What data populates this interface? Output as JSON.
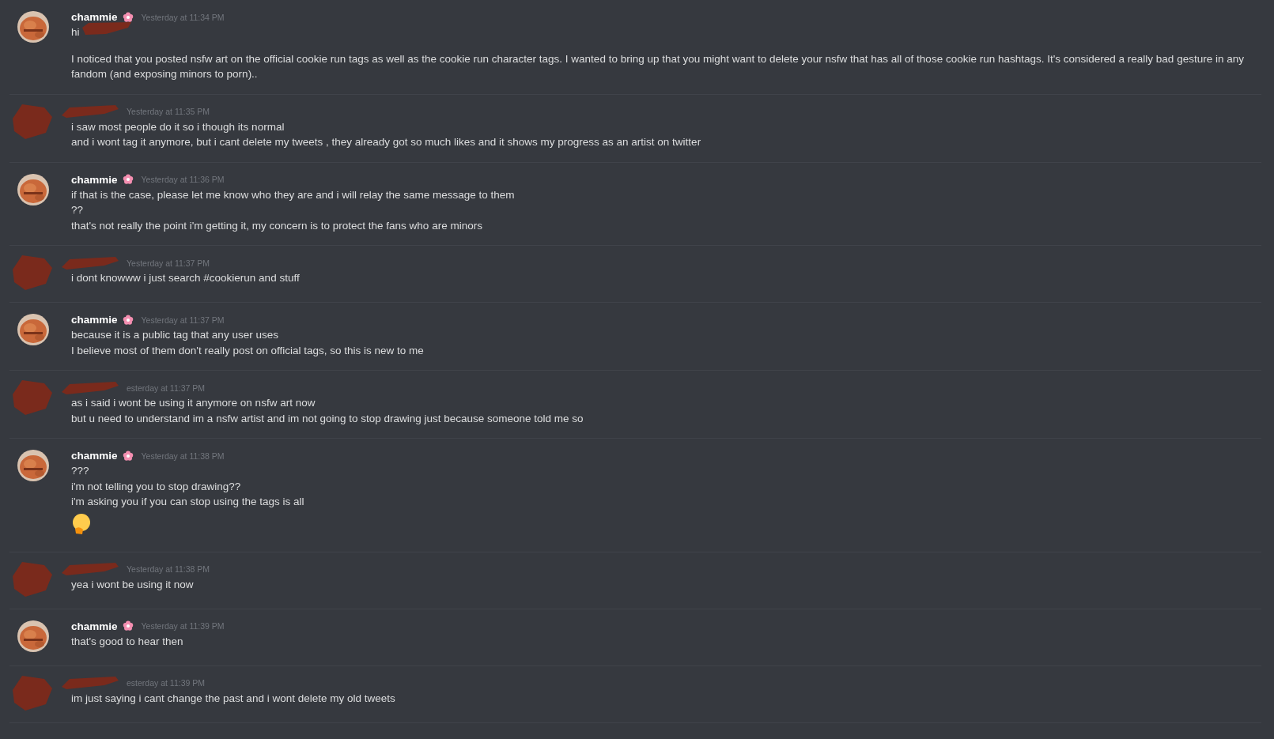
{
  "messages": [
    {
      "author": {
        "name": "chammie",
        "redacted": false,
        "badge": true
      },
      "timestamp": "Yesterday at 11:34 PM",
      "lines": [
        {
          "kind": "line",
          "text": "hi",
          "redacted_after": true
        },
        {
          "kind": "paragraph",
          "text": "I noticed that you posted nsfw art on the official cookie run tags as well as the cookie run character tags. I wanted to bring up that you might want to delete your nsfw that has all of those cookie run hashtags. It's considered a really bad gesture in any fandom (and exposing minors to porn).."
        }
      ]
    },
    {
      "author": {
        "redacted": true
      },
      "timestamp": "Yesterday at 11:35 PM",
      "lines": [
        {
          "kind": "line",
          "text": "i saw most people do it so i though its normal"
        },
        {
          "kind": "line",
          "text": "and i wont tag it anymore, but i cant delete my tweets , they already got so much likes and it shows my progress as an artist on twitter"
        }
      ]
    },
    {
      "author": {
        "name": "chammie",
        "redacted": false,
        "badge": true
      },
      "timestamp": "Yesterday at 11:36 PM",
      "lines": [
        {
          "kind": "line",
          "text": "if that is the case, please let me know who they are and i will relay the same message to them"
        },
        {
          "kind": "line",
          "text": "??"
        },
        {
          "kind": "line",
          "text": "that's not really the point i'm getting it, my concern is to protect the fans who are minors"
        }
      ]
    },
    {
      "author": {
        "redacted": true
      },
      "timestamp": "Yesterday at 11:37 PM",
      "lines": [
        {
          "kind": "line",
          "text": "i dont knowww i just search #cookierun and stuff"
        }
      ]
    },
    {
      "author": {
        "name": "chammie",
        "redacted": false,
        "badge": true
      },
      "timestamp": "Yesterday at 11:37 PM",
      "lines": [
        {
          "kind": "line",
          "text": "because it is a public tag that any user uses"
        },
        {
          "kind": "line",
          "text": "I believe most of them don't really post on official tags, so this is new to me"
        }
      ]
    },
    {
      "author": {
        "redacted": true
      },
      "timestamp": "esterday at 11:37 PM",
      "lines": [
        {
          "kind": "line",
          "text": "as i said i wont be using it anymore on nsfw art now"
        },
        {
          "kind": "line",
          "text": "but u need to understand im a nsfw artist and im not going to stop drawing just because someone told me so"
        }
      ]
    },
    {
      "author": {
        "name": "chammie",
        "redacted": false,
        "badge": true
      },
      "timestamp": "Yesterday at 11:38 PM",
      "lines": [
        {
          "kind": "line",
          "text": "???"
        },
        {
          "kind": "line",
          "text": "i'm not telling you to stop drawing??"
        },
        {
          "kind": "line",
          "text": "i'm asking you if you can stop using the tags is all"
        },
        {
          "kind": "emoji"
        }
      ]
    },
    {
      "author": {
        "redacted": true
      },
      "timestamp": "Yesterday at 11:38 PM",
      "lines": [
        {
          "kind": "line",
          "text": "yea i wont be using it now"
        }
      ]
    },
    {
      "author": {
        "name": "chammie",
        "redacted": false,
        "badge": true
      },
      "timestamp": "Yesterday at 11:39 PM",
      "lines": [
        {
          "kind": "line",
          "text": "that's good to hear then"
        }
      ]
    },
    {
      "author": {
        "redacted": true
      },
      "timestamp": "esterday at 11:39 PM",
      "lines": [
        {
          "kind": "line",
          "text": "im just saying i cant change the past and i wont delete my old tweets"
        }
      ]
    }
  ]
}
